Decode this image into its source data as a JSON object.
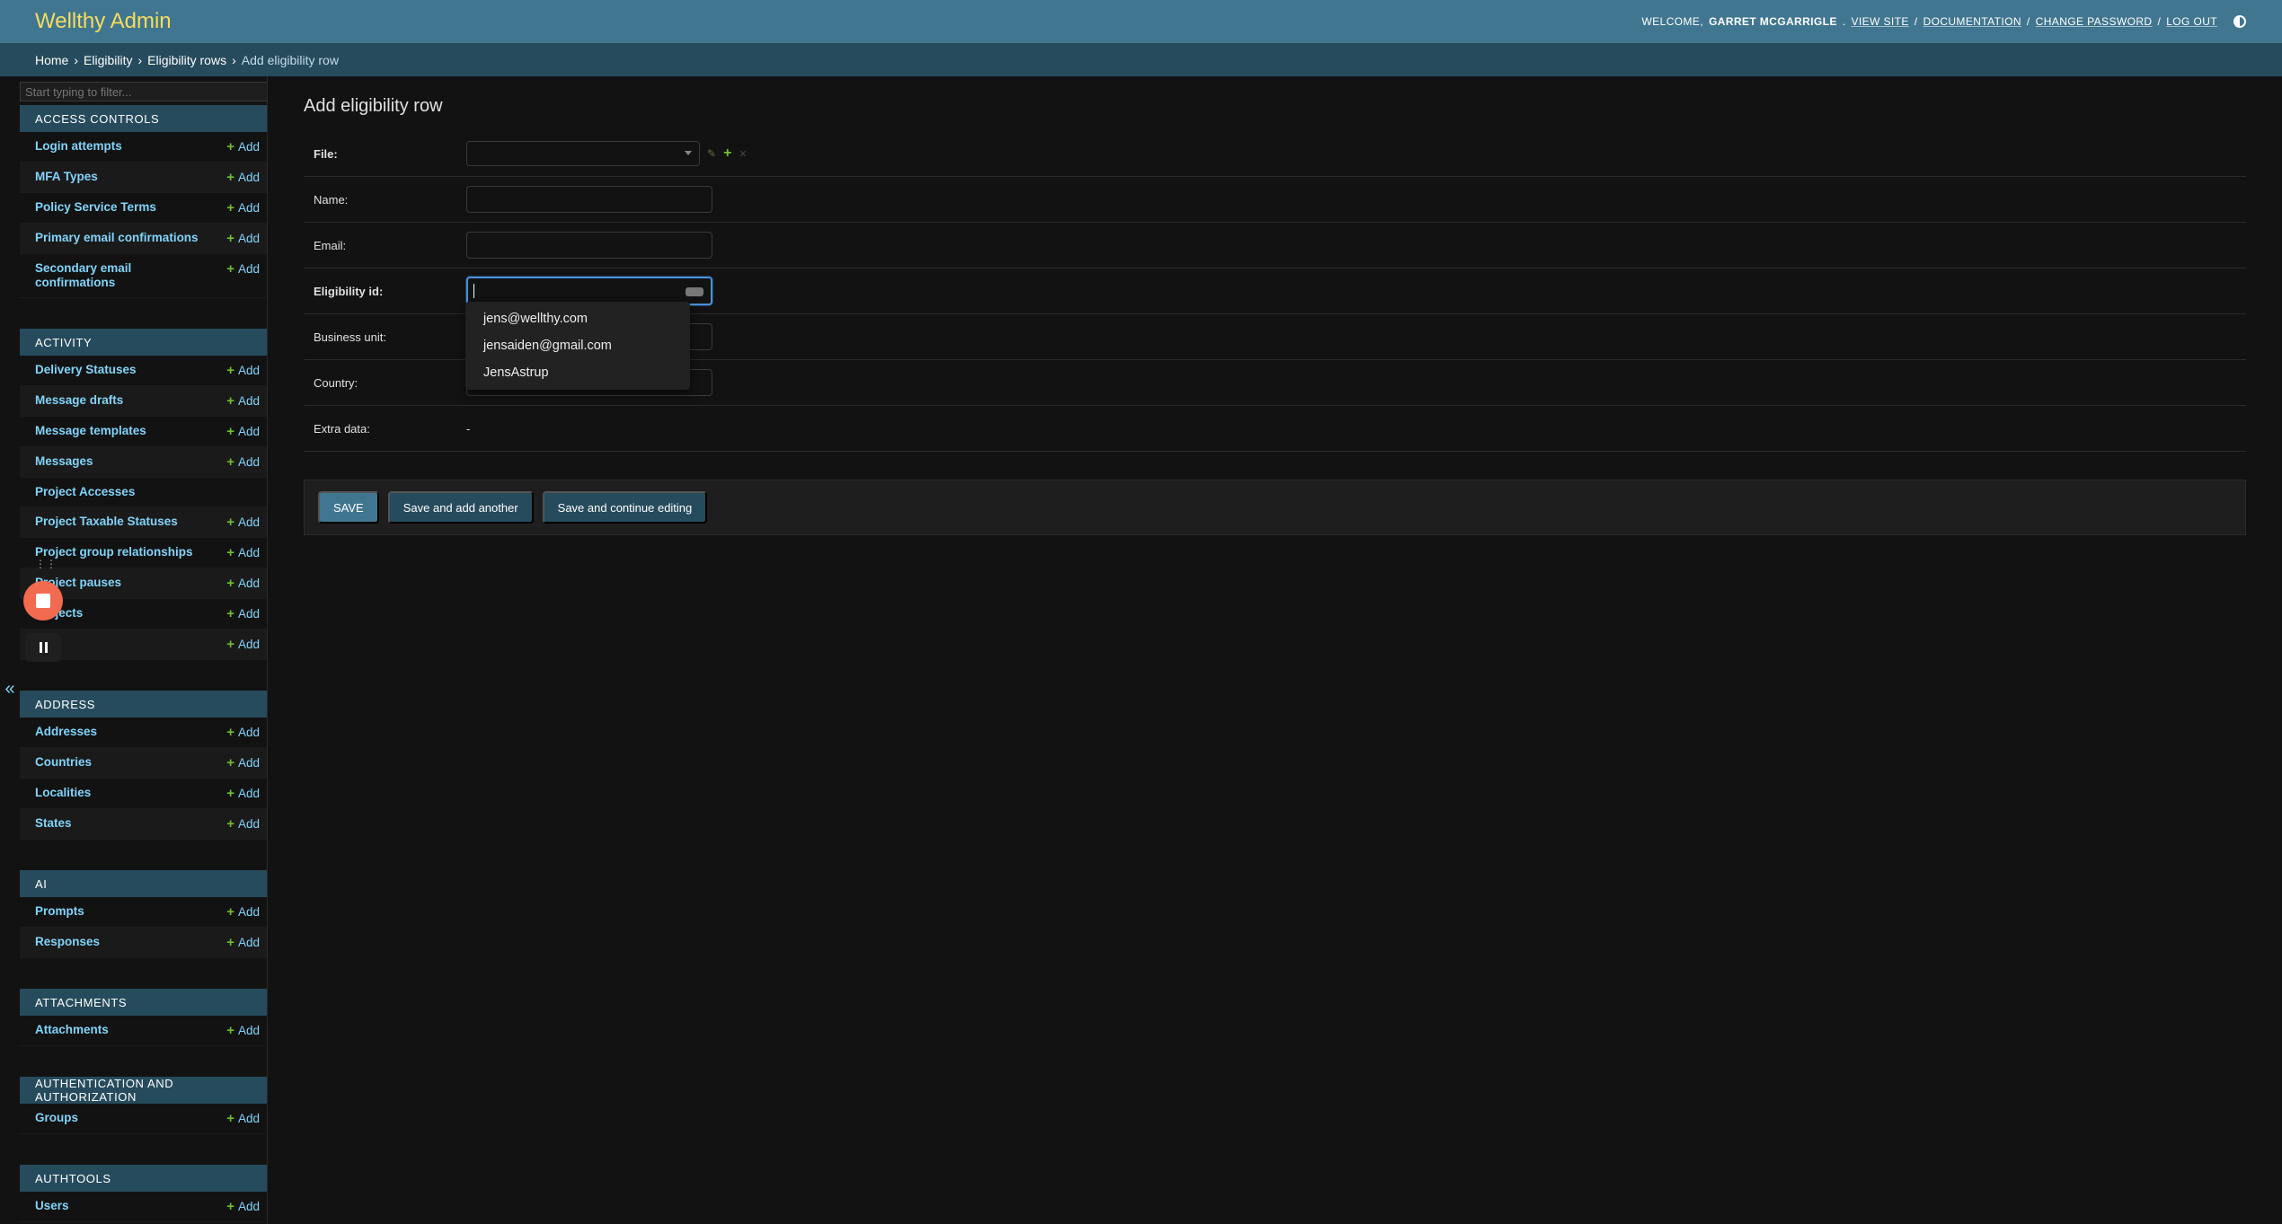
{
  "header": {
    "brand": "Wellthy Admin",
    "welcome": "Welcome,",
    "username": "Garret McGarrigle",
    "links": [
      "View site",
      "Documentation",
      "Change password",
      "Log out"
    ]
  },
  "breadcrumbs": [
    "Home",
    "Eligibility",
    "Eligibility rows",
    "Add eligibility row"
  ],
  "sidebar": {
    "filter_placeholder": "Start typing to filter...",
    "add_label": "Add",
    "toggle_label": "«",
    "modules": [
      {
        "caption": "Access Controls",
        "models": [
          {
            "name": "Login attempts",
            "add": true
          },
          {
            "name": "MFA Types",
            "add": true
          },
          {
            "name": "Policy Service Terms",
            "add": true
          },
          {
            "name": "Primary email confirmations",
            "add": true
          },
          {
            "name": "Secondary email confirmations",
            "add": true
          }
        ]
      },
      {
        "caption": "Activity",
        "models": [
          {
            "name": "Delivery Statuses",
            "add": true
          },
          {
            "name": "Message drafts",
            "add": true
          },
          {
            "name": "Message templates",
            "add": true
          },
          {
            "name": "Messages",
            "add": true
          },
          {
            "name": "Project Accesses",
            "add": false
          },
          {
            "name": "Project Taxable Statuses",
            "add": true
          },
          {
            "name": "Project group relationships",
            "add": true
          },
          {
            "name": "Project pauses",
            "add": true
          },
          {
            "name": "Projects",
            "add": true
          },
          {
            "name": "",
            "add": true
          }
        ]
      },
      {
        "caption": "Address",
        "models": [
          {
            "name": "Addresses",
            "add": true
          },
          {
            "name": "Countries",
            "add": true
          },
          {
            "name": "Localities",
            "add": true
          },
          {
            "name": "States",
            "add": true
          }
        ]
      },
      {
        "caption": "AI",
        "models": [
          {
            "name": "Prompts",
            "add": true
          },
          {
            "name": "Responses",
            "add": true
          }
        ]
      },
      {
        "caption": "Attachments",
        "models": [
          {
            "name": "Attachments",
            "add": true
          }
        ]
      },
      {
        "caption": "Authentication and Authorization",
        "models": [
          {
            "name": "Groups",
            "add": true
          }
        ]
      },
      {
        "caption": "Authtools",
        "models": [
          {
            "name": "Users",
            "add": true
          }
        ]
      },
      {
        "caption": "",
        "models": []
      }
    ]
  },
  "form": {
    "title": "Add eligibility row",
    "fields": {
      "file": {
        "label": "File:"
      },
      "name": {
        "label": "Name:"
      },
      "email": {
        "label": "Email:"
      },
      "eligibility_id": {
        "label": "Eligibility id:"
      },
      "business_unit": {
        "label": "Business unit:"
      },
      "country": {
        "label": "Country:"
      },
      "extra_data": {
        "label": "Extra data:",
        "value": "-"
      }
    },
    "autocomplete": [
      "jens@wellthy.com",
      "jensaiden@gmail.com",
      "JensAstrup"
    ],
    "buttons": {
      "save": "Save",
      "save_add": "Save and add another",
      "save_continue": "Save and continue editing"
    }
  },
  "colors": {
    "header_bg": "#417690",
    "brand": "#f5dd5d",
    "breadcrumb_bg": "#264b5d",
    "link": "#81d4fa",
    "add_plus": "#70bf2b",
    "record_button": "#f26a4f"
  }
}
